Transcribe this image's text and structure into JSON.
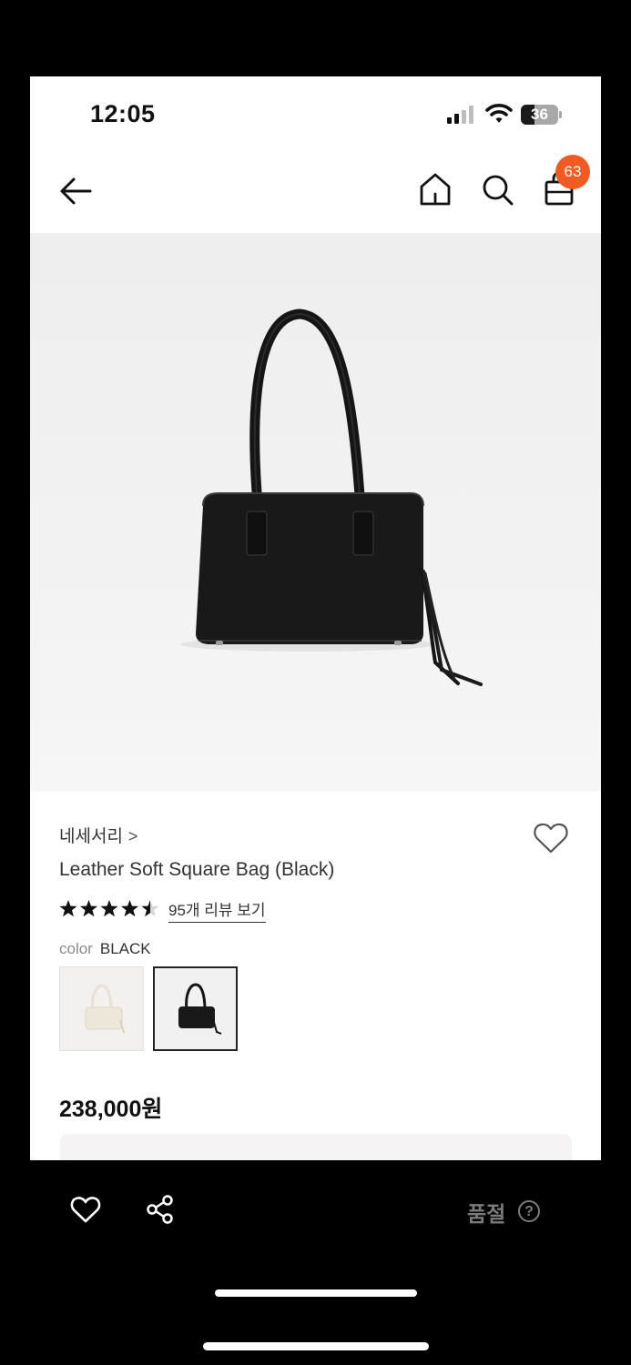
{
  "status_bar": {
    "time": "12:05",
    "battery_level": "36"
  },
  "header": {
    "back_icon": "arrow-left-icon",
    "home_icon": "home-icon",
    "search_icon": "search-icon",
    "cart_icon": "bag-icon",
    "cart_count": "63",
    "badge_color": "#f15a22"
  },
  "product": {
    "brand": "네세서리",
    "brand_chevron": ">",
    "name": "Leather Soft Square Bag (Black)",
    "rating": 4.5,
    "review_text": "95개 리뷰 보기",
    "option_label": "color",
    "option_value": "BLACK",
    "swatches": [
      {
        "color": "ivory",
        "selected": false
      },
      {
        "color": "black",
        "selected": true
      }
    ],
    "price": "238,000원"
  },
  "bottom_bar": {
    "like_icon": "heart-icon",
    "share_icon": "share-icon",
    "soldout_label": "품절",
    "help_glyph": "?"
  }
}
